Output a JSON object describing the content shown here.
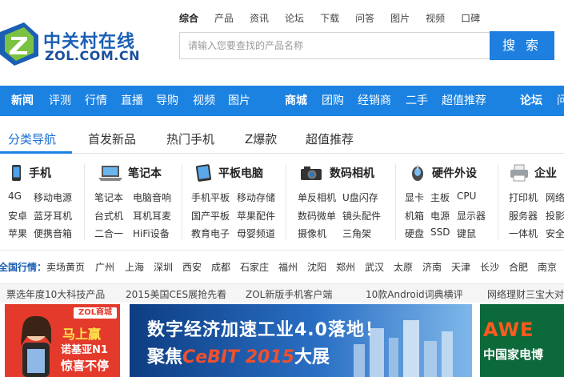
{
  "header": {
    "logo_cn": "中关村在线",
    "logo_en": "ZOL.COM.CN",
    "search_tabs": [
      "综合",
      "产品",
      "资讯",
      "论坛",
      "下载",
      "问答",
      "图片",
      "视频",
      "口碑"
    ],
    "search_placeholder": "请输入您要查找的产品名称",
    "search_button": "搜 索"
  },
  "nav": {
    "items": [
      "新闻",
      "评测",
      "行情",
      "直播",
      "导购",
      "视频",
      "图片",
      "商城",
      "团购",
      "经销商",
      "二手",
      "超值推荐",
      "论坛",
      "问"
    ]
  },
  "category_tabs": [
    "分类导航",
    "首发新品",
    "热门手机",
    "Z爆款",
    "超值推荐"
  ],
  "columns": [
    {
      "title": "手机",
      "icon": "phone-icon",
      "links": [
        "4G",
        "移动电源",
        "安卓",
        "蓝牙耳机",
        "苹果",
        "便携音箱"
      ]
    },
    {
      "title": "笔记本",
      "icon": "laptop-icon",
      "links": [
        "笔记本",
        "电脑音响",
        "台式机",
        "耳机耳麦",
        "二合一",
        "HiFi设备"
      ]
    },
    {
      "title": "平板电脑",
      "icon": "tablet-icon",
      "links": [
        "手机平板",
        "移动存储",
        "国产平板",
        "苹果配件",
        "教育电子",
        "母婴频道"
      ]
    },
    {
      "title": "数码相机",
      "icon": "camera-icon",
      "links": [
        "单反相机",
        "U盘闪存",
        "数码微单",
        "镜头配件",
        "摄像机",
        "三角架"
      ]
    },
    {
      "title": "硬件外设",
      "icon": "hardware-icon",
      "links": [
        "显卡",
        "主板",
        "CPU",
        "机箱",
        "电源",
        "显示器",
        "硬盘",
        "SSD",
        "键鼠"
      ]
    },
    {
      "title": "企业",
      "icon": "printer-icon",
      "links": [
        "打印机",
        "网络",
        "服务器",
        "投影",
        "一体机",
        "安全"
      ]
    }
  ],
  "national": {
    "label": "全国行情：",
    "cities": [
      "卖场黄页",
      "广州",
      "上海",
      "深圳",
      "西安",
      "成都",
      "石家庄",
      "福州",
      "沈阳",
      "郑州",
      "武汉",
      "太原",
      "济南",
      "天津",
      "长沙",
      "合肥",
      "南京"
    ]
  },
  "ticker": [
    "票选年度10大科技产品",
    "2015美国CES展抢先看",
    "ZOL新版手机客户端",
    "10款Android词典横评",
    "网络理财三宝大对决"
  ],
  "banners": {
    "left": {
      "brand": "ZOL商城",
      "line1": "马上赢",
      "line2": "诺基亚N1",
      "line3": "惊喜不停"
    },
    "center": {
      "line1": "数字经济加速工业4.0落地！",
      "line2a": "聚焦",
      "line2b": "CeBIT 2015",
      "line2c": "大展"
    },
    "right": {
      "line1": "AWE",
      "line2": "中国家电博"
    }
  },
  "colors": {
    "brand_blue": "#1b82e2",
    "logo_green": "#7cc242"
  }
}
